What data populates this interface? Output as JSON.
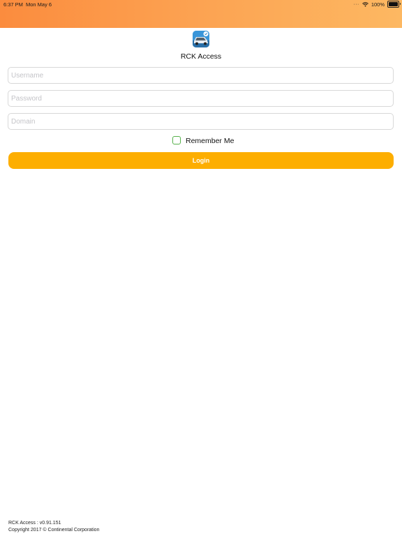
{
  "status_bar": {
    "time": "6:37 PM",
    "date": "Mon May 6",
    "battery_percent": "100%",
    "wifi_icon": "wifi-icon",
    "battery_icon": "battery-icon",
    "battery_level": 1.0
  },
  "app": {
    "title": "RCK Access",
    "icon": "car-app-icon"
  },
  "form": {
    "username": {
      "value": "",
      "placeholder": "Username"
    },
    "password": {
      "value": "",
      "placeholder": "Password"
    },
    "domain": {
      "value": "",
      "placeholder": "Domain"
    },
    "remember_me": {
      "label": "Remember Me",
      "checked": false
    },
    "login_label": "Login"
  },
  "footer": {
    "version": "RCK Access : v0.91.151",
    "copyright": "Copyright 2017 © Continental Corporation"
  },
  "colors": {
    "header_gradient_start": "#fb8c3e",
    "header_gradient_end": "#fdb862",
    "login_button": "#fdae00",
    "checkbox_border": "#55b04a"
  }
}
